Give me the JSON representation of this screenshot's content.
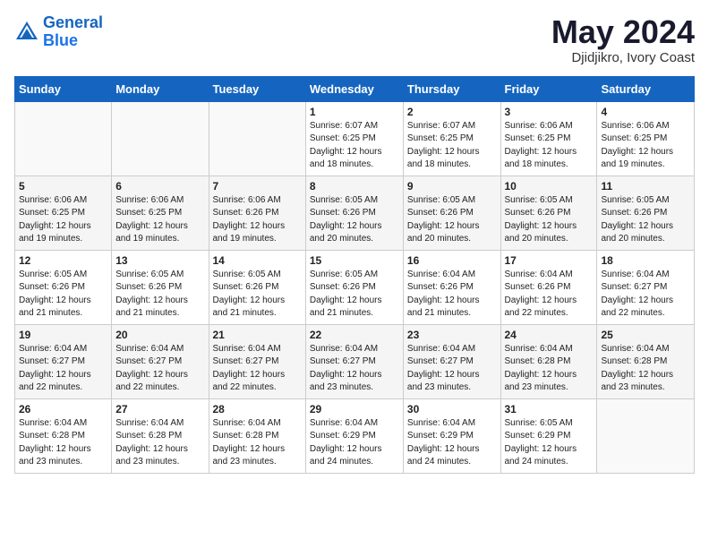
{
  "header": {
    "logo_line1": "General",
    "logo_line2": "Blue",
    "month": "May 2024",
    "location": "Djidjikro, Ivory Coast"
  },
  "weekdays": [
    "Sunday",
    "Monday",
    "Tuesday",
    "Wednesday",
    "Thursday",
    "Friday",
    "Saturday"
  ],
  "weeks": [
    [
      {
        "day": "",
        "info": ""
      },
      {
        "day": "",
        "info": ""
      },
      {
        "day": "",
        "info": ""
      },
      {
        "day": "1",
        "info": "Sunrise: 6:07 AM\nSunset: 6:25 PM\nDaylight: 12 hours\nand 18 minutes."
      },
      {
        "day": "2",
        "info": "Sunrise: 6:07 AM\nSunset: 6:25 PM\nDaylight: 12 hours\nand 18 minutes."
      },
      {
        "day": "3",
        "info": "Sunrise: 6:06 AM\nSunset: 6:25 PM\nDaylight: 12 hours\nand 18 minutes."
      },
      {
        "day": "4",
        "info": "Sunrise: 6:06 AM\nSunset: 6:25 PM\nDaylight: 12 hours\nand 19 minutes."
      }
    ],
    [
      {
        "day": "5",
        "info": "Sunrise: 6:06 AM\nSunset: 6:25 PM\nDaylight: 12 hours\nand 19 minutes."
      },
      {
        "day": "6",
        "info": "Sunrise: 6:06 AM\nSunset: 6:25 PM\nDaylight: 12 hours\nand 19 minutes."
      },
      {
        "day": "7",
        "info": "Sunrise: 6:06 AM\nSunset: 6:26 PM\nDaylight: 12 hours\nand 19 minutes."
      },
      {
        "day": "8",
        "info": "Sunrise: 6:05 AM\nSunset: 6:26 PM\nDaylight: 12 hours\nand 20 minutes."
      },
      {
        "day": "9",
        "info": "Sunrise: 6:05 AM\nSunset: 6:26 PM\nDaylight: 12 hours\nand 20 minutes."
      },
      {
        "day": "10",
        "info": "Sunrise: 6:05 AM\nSunset: 6:26 PM\nDaylight: 12 hours\nand 20 minutes."
      },
      {
        "day": "11",
        "info": "Sunrise: 6:05 AM\nSunset: 6:26 PM\nDaylight: 12 hours\nand 20 minutes."
      }
    ],
    [
      {
        "day": "12",
        "info": "Sunrise: 6:05 AM\nSunset: 6:26 PM\nDaylight: 12 hours\nand 21 minutes."
      },
      {
        "day": "13",
        "info": "Sunrise: 6:05 AM\nSunset: 6:26 PM\nDaylight: 12 hours\nand 21 minutes."
      },
      {
        "day": "14",
        "info": "Sunrise: 6:05 AM\nSunset: 6:26 PM\nDaylight: 12 hours\nand 21 minutes."
      },
      {
        "day": "15",
        "info": "Sunrise: 6:05 AM\nSunset: 6:26 PM\nDaylight: 12 hours\nand 21 minutes."
      },
      {
        "day": "16",
        "info": "Sunrise: 6:04 AM\nSunset: 6:26 PM\nDaylight: 12 hours\nand 21 minutes."
      },
      {
        "day": "17",
        "info": "Sunrise: 6:04 AM\nSunset: 6:26 PM\nDaylight: 12 hours\nand 22 minutes."
      },
      {
        "day": "18",
        "info": "Sunrise: 6:04 AM\nSunset: 6:27 PM\nDaylight: 12 hours\nand 22 minutes."
      }
    ],
    [
      {
        "day": "19",
        "info": "Sunrise: 6:04 AM\nSunset: 6:27 PM\nDaylight: 12 hours\nand 22 minutes."
      },
      {
        "day": "20",
        "info": "Sunrise: 6:04 AM\nSunset: 6:27 PM\nDaylight: 12 hours\nand 22 minutes."
      },
      {
        "day": "21",
        "info": "Sunrise: 6:04 AM\nSunset: 6:27 PM\nDaylight: 12 hours\nand 22 minutes."
      },
      {
        "day": "22",
        "info": "Sunrise: 6:04 AM\nSunset: 6:27 PM\nDaylight: 12 hours\nand 23 minutes."
      },
      {
        "day": "23",
        "info": "Sunrise: 6:04 AM\nSunset: 6:27 PM\nDaylight: 12 hours\nand 23 minutes."
      },
      {
        "day": "24",
        "info": "Sunrise: 6:04 AM\nSunset: 6:28 PM\nDaylight: 12 hours\nand 23 minutes."
      },
      {
        "day": "25",
        "info": "Sunrise: 6:04 AM\nSunset: 6:28 PM\nDaylight: 12 hours\nand 23 minutes."
      }
    ],
    [
      {
        "day": "26",
        "info": "Sunrise: 6:04 AM\nSunset: 6:28 PM\nDaylight: 12 hours\nand 23 minutes."
      },
      {
        "day": "27",
        "info": "Sunrise: 6:04 AM\nSunset: 6:28 PM\nDaylight: 12 hours\nand 23 minutes."
      },
      {
        "day": "28",
        "info": "Sunrise: 6:04 AM\nSunset: 6:28 PM\nDaylight: 12 hours\nand 23 minutes."
      },
      {
        "day": "29",
        "info": "Sunrise: 6:04 AM\nSunset: 6:29 PM\nDaylight: 12 hours\nand 24 minutes."
      },
      {
        "day": "30",
        "info": "Sunrise: 6:04 AM\nSunset: 6:29 PM\nDaylight: 12 hours\nand 24 minutes."
      },
      {
        "day": "31",
        "info": "Sunrise: 6:05 AM\nSunset: 6:29 PM\nDaylight: 12 hours\nand 24 minutes."
      },
      {
        "day": "",
        "info": ""
      }
    ]
  ]
}
